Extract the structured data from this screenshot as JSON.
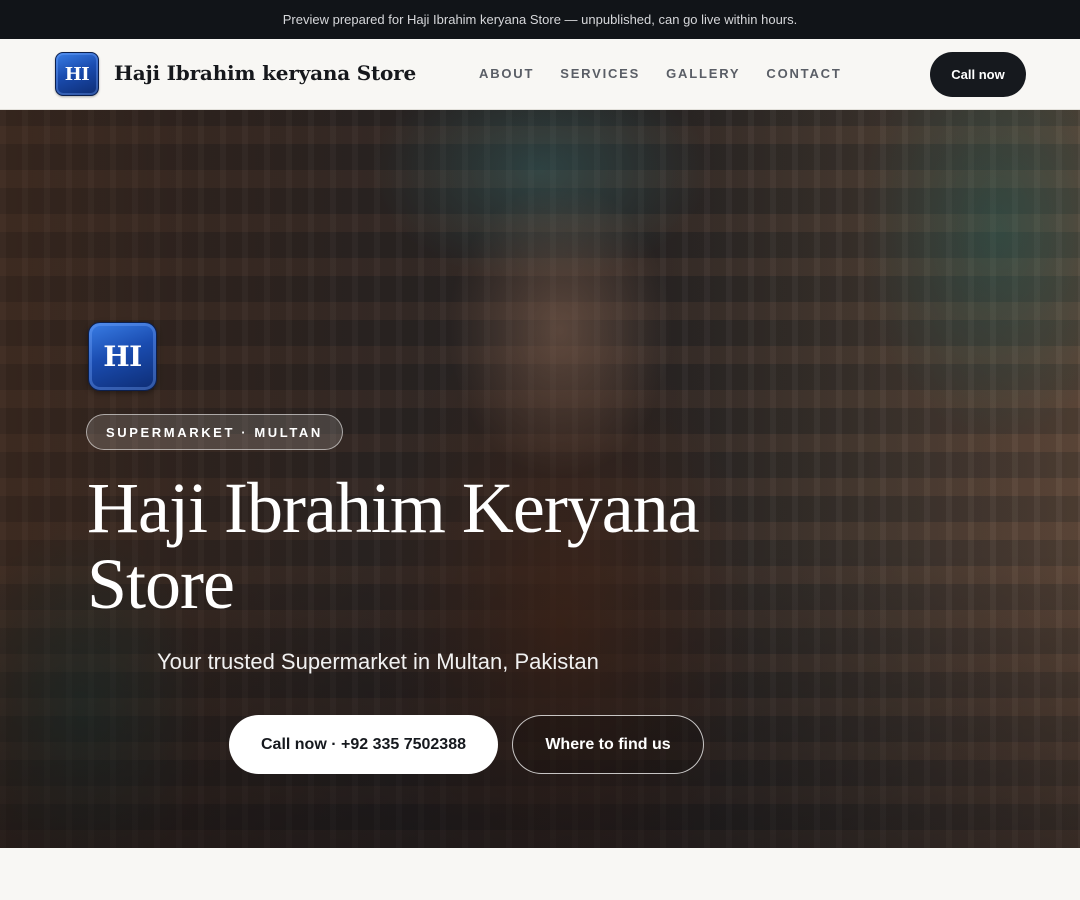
{
  "announcement": {
    "text": "Preview prepared for Haji Ibrahim keryana Store — unpublished, can go live within hours."
  },
  "navbar": {
    "logo_initials": "HI",
    "brand_name": "Haji Ibrahim keryana Store",
    "links": [
      {
        "label": "ABOUT"
      },
      {
        "label": "SERVICES"
      },
      {
        "label": "GALLERY"
      },
      {
        "label": "CONTACT"
      }
    ],
    "cta_label": "Call now"
  },
  "hero": {
    "logo_initials": "HI",
    "category_pill": "SUPERMARKET · MULTAN",
    "title": "Haji Ibrahim Keryana Store",
    "subtitle": "Your trusted Supermarket in Multan, Pakistan",
    "primary_button": "Call now · +92 335 7502388",
    "secondary_button": "Where to find us"
  },
  "colors": {
    "announcement_bg": "#111418",
    "nav_bg": "#f8f7f4",
    "dark_button": "#16191e",
    "logo_blue": "#1a4cb0"
  }
}
